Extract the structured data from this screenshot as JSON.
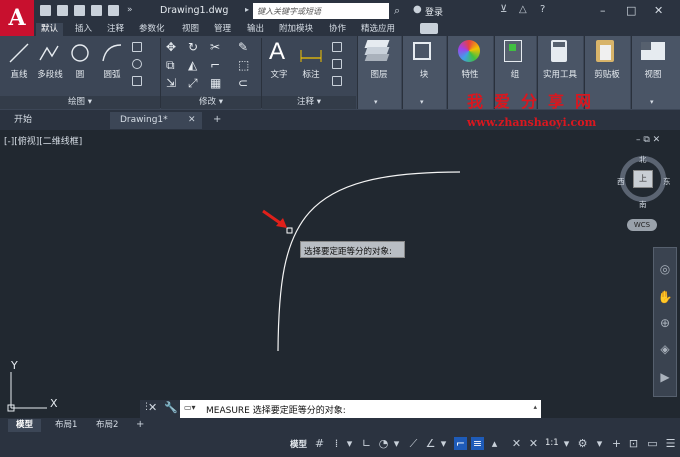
{
  "app": {
    "logo_letter": "A",
    "document_title": "Drawing1.dwg",
    "search_placeholder": "键入关键字或短语",
    "login_label": "登录"
  },
  "ribbon_tabs": [
    "默认",
    "插入",
    "注释",
    "参数化",
    "视图",
    "管理",
    "输出",
    "附加模块",
    "协作",
    "精选应用"
  ],
  "ribbon": {
    "draw": {
      "line": "直线",
      "polyline": "多段线",
      "circle": "圆",
      "arc": "圆弧",
      "panel_title": "绘图"
    },
    "modify": {
      "panel_title": "修改"
    },
    "annotation": {
      "text": "文字",
      "dimension": "标注",
      "panel_title": "注释"
    },
    "layer": "图层",
    "block": "块",
    "properties": "特性",
    "group": "组",
    "utilities": "实用工具",
    "clipboard": "剪贴板",
    "view": "视图"
  },
  "file_tabs": {
    "start": "开始",
    "drawing": "Drawing1*",
    "add": "+"
  },
  "viewport_label": "[-][俯视][二维线框]",
  "tooltip": "选择要定距等分的对象:",
  "watermark": {
    "cn": "我爱分享网",
    "url": "www.zhanshaoyi.com"
  },
  "viewcube": {
    "north": "北",
    "south": "南",
    "east": "东",
    "west": "西",
    "top": "上",
    "wcs": "WCS"
  },
  "ucs": {
    "x": "X",
    "y": "Y"
  },
  "command_line": {
    "text": "MEASURE 选择要定距等分的对象:"
  },
  "layout_tabs": [
    "模型",
    "布局1",
    "布局2"
  ],
  "status": {
    "model": "模型",
    "scale": "1:1"
  },
  "colors": {
    "accent": "#1e5bb8",
    "app_red": "#c8102e",
    "watermark_red": "#d9171f",
    "canvas": "#212830"
  }
}
